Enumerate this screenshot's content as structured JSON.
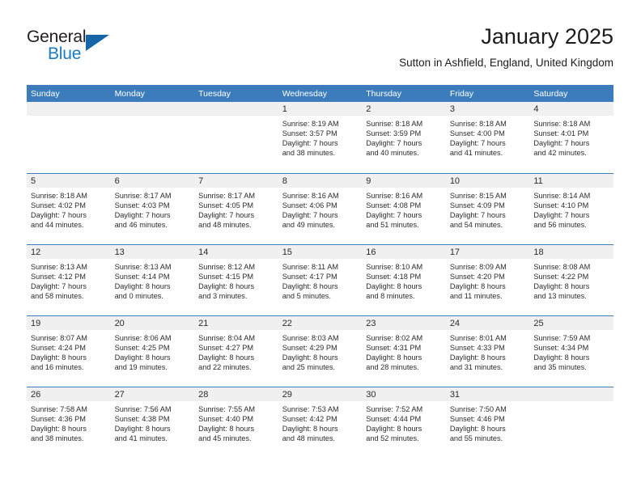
{
  "brand": {
    "name_top": "General",
    "name_bottom": "Blue",
    "accent_color": "#1565a8",
    "text_color": "#231f20"
  },
  "header": {
    "title": "January 2025",
    "subtitle": "Sutton in Ashfield, England, United Kingdom"
  },
  "theme": {
    "header_row_bg": "#3d7cbc",
    "daynum_band_bg": "#f0f0f0",
    "cell_bg": "#ffffff",
    "separator_color": "#3d7cbc",
    "text_color": "#2b2b2b"
  },
  "columns": [
    "Sunday",
    "Monday",
    "Tuesday",
    "Wednesday",
    "Thursday",
    "Friday",
    "Saturday"
  ],
  "weeks": [
    [
      {
        "day": "",
        "lines": []
      },
      {
        "day": "",
        "lines": []
      },
      {
        "day": "",
        "lines": []
      },
      {
        "day": "1",
        "lines": [
          "Sunrise: 8:19 AM",
          "Sunset: 3:57 PM",
          "Daylight: 7 hours",
          "and 38 minutes."
        ]
      },
      {
        "day": "2",
        "lines": [
          "Sunrise: 8:18 AM",
          "Sunset: 3:59 PM",
          "Daylight: 7 hours",
          "and 40 minutes."
        ]
      },
      {
        "day": "3",
        "lines": [
          "Sunrise: 8:18 AM",
          "Sunset: 4:00 PM",
          "Daylight: 7 hours",
          "and 41 minutes."
        ]
      },
      {
        "day": "4",
        "lines": [
          "Sunrise: 8:18 AM",
          "Sunset: 4:01 PM",
          "Daylight: 7 hours",
          "and 42 minutes."
        ]
      }
    ],
    [
      {
        "day": "5",
        "lines": [
          "Sunrise: 8:18 AM",
          "Sunset: 4:02 PM",
          "Daylight: 7 hours",
          "and 44 minutes."
        ]
      },
      {
        "day": "6",
        "lines": [
          "Sunrise: 8:17 AM",
          "Sunset: 4:03 PM",
          "Daylight: 7 hours",
          "and 46 minutes."
        ]
      },
      {
        "day": "7",
        "lines": [
          "Sunrise: 8:17 AM",
          "Sunset: 4:05 PM",
          "Daylight: 7 hours",
          "and 48 minutes."
        ]
      },
      {
        "day": "8",
        "lines": [
          "Sunrise: 8:16 AM",
          "Sunset: 4:06 PM",
          "Daylight: 7 hours",
          "and 49 minutes."
        ]
      },
      {
        "day": "9",
        "lines": [
          "Sunrise: 8:16 AM",
          "Sunset: 4:08 PM",
          "Daylight: 7 hours",
          "and 51 minutes."
        ]
      },
      {
        "day": "10",
        "lines": [
          "Sunrise: 8:15 AM",
          "Sunset: 4:09 PM",
          "Daylight: 7 hours",
          "and 54 minutes."
        ]
      },
      {
        "day": "11",
        "lines": [
          "Sunrise: 8:14 AM",
          "Sunset: 4:10 PM",
          "Daylight: 7 hours",
          "and 56 minutes."
        ]
      }
    ],
    [
      {
        "day": "12",
        "lines": [
          "Sunrise: 8:13 AM",
          "Sunset: 4:12 PM",
          "Daylight: 7 hours",
          "and 58 minutes."
        ]
      },
      {
        "day": "13",
        "lines": [
          "Sunrise: 8:13 AM",
          "Sunset: 4:14 PM",
          "Daylight: 8 hours",
          "and 0 minutes."
        ]
      },
      {
        "day": "14",
        "lines": [
          "Sunrise: 8:12 AM",
          "Sunset: 4:15 PM",
          "Daylight: 8 hours",
          "and 3 minutes."
        ]
      },
      {
        "day": "15",
        "lines": [
          "Sunrise: 8:11 AM",
          "Sunset: 4:17 PM",
          "Daylight: 8 hours",
          "and 5 minutes."
        ]
      },
      {
        "day": "16",
        "lines": [
          "Sunrise: 8:10 AM",
          "Sunset: 4:18 PM",
          "Daylight: 8 hours",
          "and 8 minutes."
        ]
      },
      {
        "day": "17",
        "lines": [
          "Sunrise: 8:09 AM",
          "Sunset: 4:20 PM",
          "Daylight: 8 hours",
          "and 11 minutes."
        ]
      },
      {
        "day": "18",
        "lines": [
          "Sunrise: 8:08 AM",
          "Sunset: 4:22 PM",
          "Daylight: 8 hours",
          "and 13 minutes."
        ]
      }
    ],
    [
      {
        "day": "19",
        "lines": [
          "Sunrise: 8:07 AM",
          "Sunset: 4:24 PM",
          "Daylight: 8 hours",
          "and 16 minutes."
        ]
      },
      {
        "day": "20",
        "lines": [
          "Sunrise: 8:06 AM",
          "Sunset: 4:25 PM",
          "Daylight: 8 hours",
          "and 19 minutes."
        ]
      },
      {
        "day": "21",
        "lines": [
          "Sunrise: 8:04 AM",
          "Sunset: 4:27 PM",
          "Daylight: 8 hours",
          "and 22 minutes."
        ]
      },
      {
        "day": "22",
        "lines": [
          "Sunrise: 8:03 AM",
          "Sunset: 4:29 PM",
          "Daylight: 8 hours",
          "and 25 minutes."
        ]
      },
      {
        "day": "23",
        "lines": [
          "Sunrise: 8:02 AM",
          "Sunset: 4:31 PM",
          "Daylight: 8 hours",
          "and 28 minutes."
        ]
      },
      {
        "day": "24",
        "lines": [
          "Sunrise: 8:01 AM",
          "Sunset: 4:33 PM",
          "Daylight: 8 hours",
          "and 31 minutes."
        ]
      },
      {
        "day": "25",
        "lines": [
          "Sunrise: 7:59 AM",
          "Sunset: 4:34 PM",
          "Daylight: 8 hours",
          "and 35 minutes."
        ]
      }
    ],
    [
      {
        "day": "26",
        "lines": [
          "Sunrise: 7:58 AM",
          "Sunset: 4:36 PM",
          "Daylight: 8 hours",
          "and 38 minutes."
        ]
      },
      {
        "day": "27",
        "lines": [
          "Sunrise: 7:56 AM",
          "Sunset: 4:38 PM",
          "Daylight: 8 hours",
          "and 41 minutes."
        ]
      },
      {
        "day": "28",
        "lines": [
          "Sunrise: 7:55 AM",
          "Sunset: 4:40 PM",
          "Daylight: 8 hours",
          "and 45 minutes."
        ]
      },
      {
        "day": "29",
        "lines": [
          "Sunrise: 7:53 AM",
          "Sunset: 4:42 PM",
          "Daylight: 8 hours",
          "and 48 minutes."
        ]
      },
      {
        "day": "30",
        "lines": [
          "Sunrise: 7:52 AM",
          "Sunset: 4:44 PM",
          "Daylight: 8 hours",
          "and 52 minutes."
        ]
      },
      {
        "day": "31",
        "lines": [
          "Sunrise: 7:50 AM",
          "Sunset: 4:46 PM",
          "Daylight: 8 hours",
          "and 55 minutes."
        ]
      },
      {
        "day": "",
        "lines": []
      }
    ]
  ]
}
